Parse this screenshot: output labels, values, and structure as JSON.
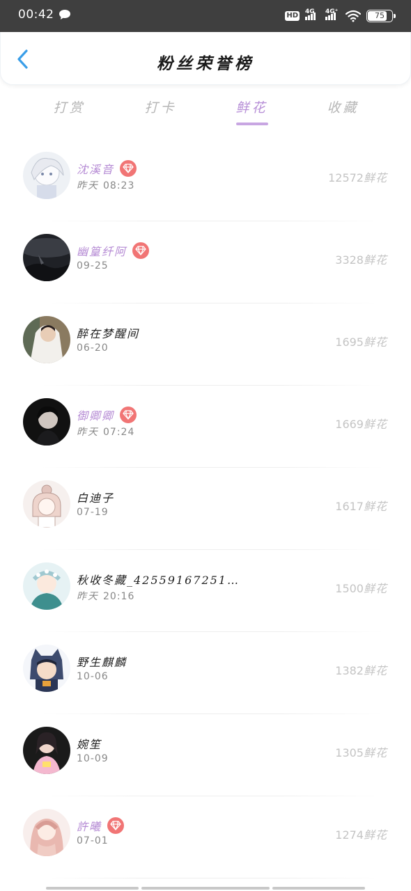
{
  "status_bar": {
    "time": "00:42",
    "hd_label": "HD",
    "net1": "4G",
    "net2": "4G⁺",
    "battery": "75"
  },
  "header": {
    "title": "粉丝荣誉榜",
    "back_icon": "chevron-left-icon"
  },
  "tabs": [
    {
      "label": "打赏",
      "active": false
    },
    {
      "label": "打卡",
      "active": false
    },
    {
      "label": "鲜花",
      "active": true
    },
    {
      "label": "收藏",
      "active": false
    }
  ],
  "colors": {
    "accent_purple": "#b78fd7",
    "vip_badge": "#f17575",
    "score_gray": "#c4c4c4",
    "status_bar_bg": "#3f3f3f"
  },
  "list": [
    {
      "name": "沈溪音",
      "vip": true,
      "date_prefix": "昨天",
      "date": "08:23",
      "score": "12572",
      "unit": "鲜花",
      "avatar_icon": "anime-white-hair-avatar"
    },
    {
      "name": "幽篁纤阿",
      "vip": true,
      "date_prefix": "",
      "date": "09-25",
      "score": "3328",
      "unit": "鲜花",
      "avatar_icon": "dark-scenery-avatar"
    },
    {
      "name": "醉在梦醒间",
      "vip": false,
      "date_prefix": "",
      "date": "06-20",
      "score": "1695",
      "unit": "鲜花",
      "avatar_icon": "bride-photo-avatar"
    },
    {
      "name": "御卿卿",
      "vip": true,
      "date_prefix": "昨天",
      "date": "07:24",
      "score": "1669",
      "unit": "鲜花",
      "avatar_icon": "man-portrait-avatar"
    },
    {
      "name": "白迪子",
      "vip": false,
      "date_prefix": "",
      "date": "07-19",
      "score": "1617",
      "unit": "鲜花",
      "avatar_icon": "sketch-girl-avatar"
    },
    {
      "name": "秋收冬藏_42559167251…",
      "vip": false,
      "date_prefix": "昨天",
      "date": "20:16",
      "score": "1500",
      "unit": "鲜花",
      "avatar_icon": "anime-flower-crown-avatar"
    },
    {
      "name": "野生麒麟",
      "vip": false,
      "date_prefix": "",
      "date": "10-06",
      "score": "1382",
      "unit": "鲜花",
      "avatar_icon": "cat-hood-boy-avatar"
    },
    {
      "name": "婉笙",
      "vip": false,
      "date_prefix": "",
      "date": "10-09",
      "score": "1305",
      "unit": "鲜花",
      "avatar_icon": "girl-photo-avatar"
    },
    {
      "name": "許曦",
      "vip": true,
      "date_prefix": "",
      "date": "07-01",
      "score": "1274",
      "unit": "鲜花",
      "avatar_icon": "anime-pink-hair-avatar"
    }
  ]
}
